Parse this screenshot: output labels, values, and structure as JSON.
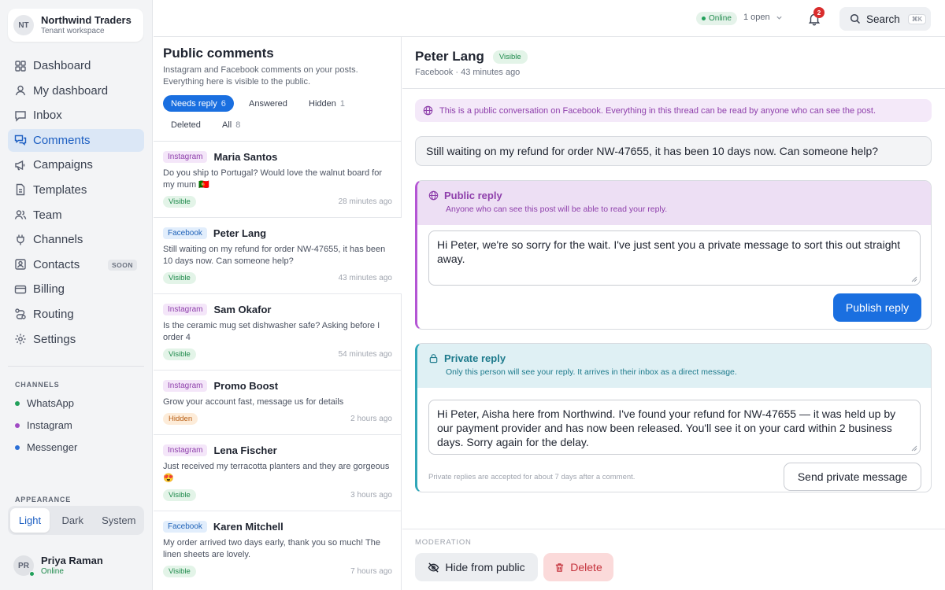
{
  "workspace": {
    "initials": "NT",
    "name": "Northwind Traders",
    "subtitle": "Tenant workspace"
  },
  "nav": [
    {
      "label": "Dashboard",
      "icon": "grid-icon"
    },
    {
      "label": "My dashboard",
      "icon": "user-icon"
    },
    {
      "label": "Inbox",
      "icon": "chat-icon"
    },
    {
      "label": "Comments",
      "icon": "comments-icon",
      "active": true
    },
    {
      "label": "Campaigns",
      "icon": "megaphone-icon"
    },
    {
      "label": "Templates",
      "icon": "document-icon"
    },
    {
      "label": "Team",
      "icon": "team-icon"
    },
    {
      "label": "Channels",
      "icon": "plug-icon"
    },
    {
      "label": "Contacts",
      "icon": "contact-icon",
      "badge": "SOON"
    },
    {
      "label": "Billing",
      "icon": "card-icon"
    },
    {
      "label": "Routing",
      "icon": "routing-icon"
    },
    {
      "label": "Settings",
      "icon": "gear-icon"
    }
  ],
  "channels": {
    "label": "CHANNELS",
    "items": [
      {
        "label": "WhatsApp",
        "color": "#22a05b"
      },
      {
        "label": "Instagram",
        "color": "#a04bc4"
      },
      {
        "label": "Messenger",
        "color": "#2b6fd6"
      }
    ]
  },
  "appearance": {
    "label": "APPEARANCE",
    "options": [
      "Light",
      "Dark",
      "System"
    ],
    "selected": "Light"
  },
  "user": {
    "initials": "PR",
    "name": "Priya Raman",
    "status": "Online"
  },
  "topbar": {
    "status": "Online",
    "open": "1 open",
    "notifications": "2",
    "search": "Search",
    "shortcut": "⌘K"
  },
  "list": {
    "title": "Public comments",
    "description": "Instagram and Facebook comments on your posts. Everything here is visible to the public.",
    "filters": [
      {
        "label": "Needs reply",
        "count": "6",
        "active": true
      },
      {
        "label": "Answered",
        "count": ""
      },
      {
        "label": "Hidden",
        "count": "1"
      },
      {
        "label": "Deleted",
        "count": ""
      },
      {
        "label": "All",
        "count": "8"
      }
    ],
    "items": [
      {
        "platform": "Instagram",
        "name": "Maria Santos",
        "text": "Do you ship to Portugal? Would love the walnut board for my mum 🇵🇹",
        "status": "Visible",
        "time": "28 minutes ago"
      },
      {
        "platform": "Facebook",
        "name": "Peter Lang",
        "text": "Still waiting on my refund for order NW-47655, it has been 10 days now. Can someone help?",
        "status": "Visible",
        "time": "43 minutes ago"
      },
      {
        "platform": "Instagram",
        "name": "Sam Okafor",
        "text": "Is the ceramic mug set dishwasher safe? Asking before I order 4",
        "status": "Visible",
        "time": "54 minutes ago"
      },
      {
        "platform": "Instagram",
        "name": "Promo Boost",
        "text": "Grow your account fast, message us for details",
        "status": "Hidden",
        "time": "2 hours ago"
      },
      {
        "platform": "Instagram",
        "name": "Lena Fischer",
        "text": "Just received my terracotta planters and they are gorgeous 😍",
        "status": "Visible",
        "time": "3 hours ago"
      },
      {
        "platform": "Facebook",
        "name": "Karen Mitchell",
        "text": "My order arrived two days early, thank you so much! The linen sheets are lovely.",
        "status": "Visible",
        "time": "7 hours ago"
      }
    ]
  },
  "detail": {
    "name": "Peter Lang",
    "visibility": "Visible",
    "meta": "Facebook · 43 minutes ago",
    "public_note": "This is a public conversation on Facebook. Everything in this thread can be read by anyone who can see the post.",
    "comment": "Still waiting on my refund for order NW-47655, it has been 10 days now. Can someone help?",
    "public_reply": {
      "title": "Public reply",
      "subtitle": "Anyone who can see this post will be able to read your reply.",
      "text": "Hi Peter, we're so sorry for the wait. I've just sent you a private message to sort this out straight away.",
      "button": "Publish reply"
    },
    "private_reply": {
      "title": "Private reply",
      "subtitle": "Only this person will see your reply. It arrives in their inbox as a direct message.",
      "text": "Hi Peter, Aisha here from Northwind. I've found your refund for NW-47655 — it was held up by our payment provider and has now been released. You'll see it on your card within 2 business days. Sorry again for the delay.",
      "note": "Private replies are accepted for about 7 days after a comment.",
      "button": "Send private message"
    },
    "moderation": {
      "label": "MODERATION",
      "hide": "Hide from public",
      "delete": "Delete"
    }
  },
  "colors": {
    "accent": "#1a6fe0",
    "instagram": "#8e3fab",
    "facebook": "#2163b8",
    "visible": "#1f8a4c",
    "hidden": "#b85d12",
    "danger": "#c4313b",
    "private": "#1d7a8c"
  }
}
